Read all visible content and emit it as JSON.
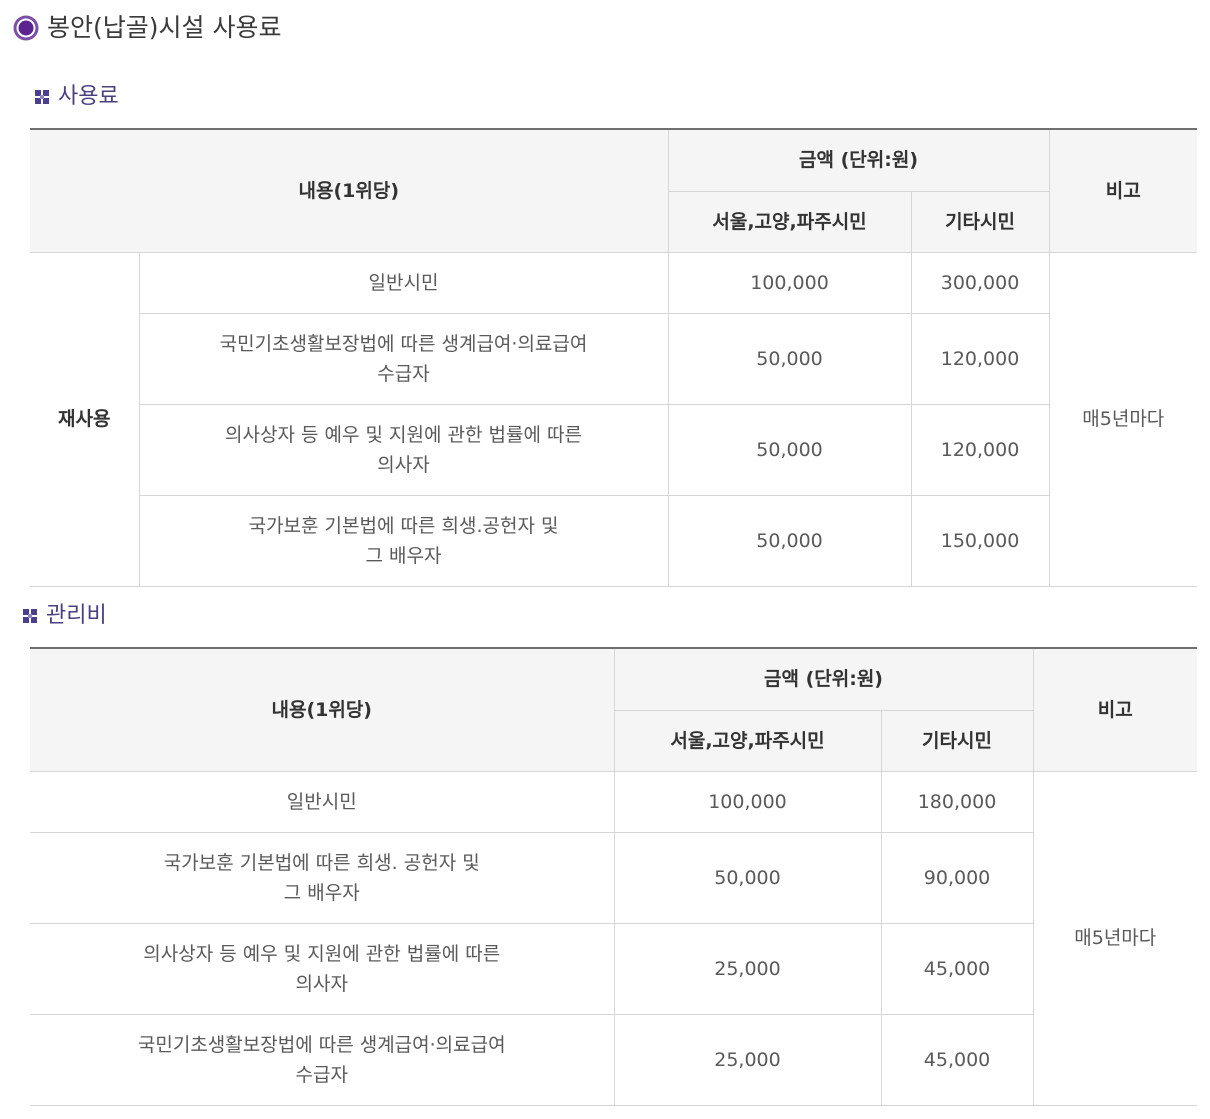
{
  "page_title": "봉안(납골)시설 사용료",
  "icons": {
    "title": "radio-bullet-icon",
    "section": "section-bullet-icon"
  },
  "colors": {
    "accent": "#4b3f80",
    "title_icon": "#7b4ea8",
    "header_bg": "#f5f5f5",
    "table_top_border": "#6f6f6f",
    "cell_border": "#d6d6d6",
    "body_text": "#5a5a5a"
  },
  "usage_fee": {
    "heading": "사용료",
    "header": {
      "content": "내용(1위당)",
      "amount": "금액 (단위:원)",
      "local": "서울,고양,파주시민",
      "other": "기타시민",
      "note": "비고"
    },
    "group": "재사용",
    "note": "매5년마다",
    "rows": [
      {
        "label": [
          "일반시민"
        ],
        "local": "100,000",
        "other": "300,000"
      },
      {
        "label": [
          "국민기초생활보장법에 따른 생계급여·의료급여",
          "수급자"
        ],
        "local": "50,000",
        "other": "120,000"
      },
      {
        "label": [
          "의사상자 등 예우 및 지원에 관한 법률에 따른",
          "의사자"
        ],
        "local": "50,000",
        "other": "120,000"
      },
      {
        "label": [
          "국가보훈 기본법에 따른 희생.공헌자 및",
          "그 배우자"
        ],
        "local": "50,000",
        "other": "150,000"
      }
    ]
  },
  "management_fee": {
    "heading": "관리비",
    "header": {
      "content": "내용(1위당)",
      "amount": "금액 (단위:원)",
      "local": "서울,고양,파주시민",
      "other": "기타시민",
      "note": "비고"
    },
    "note": "매5년마다",
    "rows": [
      {
        "label": [
          "일반시민"
        ],
        "local": "100,000",
        "other": "180,000"
      },
      {
        "label": [
          "국가보훈 기본법에 따른 희생. 공헌자 및",
          "그 배우자"
        ],
        "local": "50,000",
        "other": "90,000"
      },
      {
        "label": [
          "의사상자 등 예우 및 지원에 관한 법률에 따른",
          "의사자"
        ],
        "local": "25,000",
        "other": "45,000"
      },
      {
        "label": [
          "국민기초생활보장법에 따른 생계급여·의료급여",
          "수급자"
        ],
        "local": "25,000",
        "other": "45,000"
      }
    ]
  }
}
